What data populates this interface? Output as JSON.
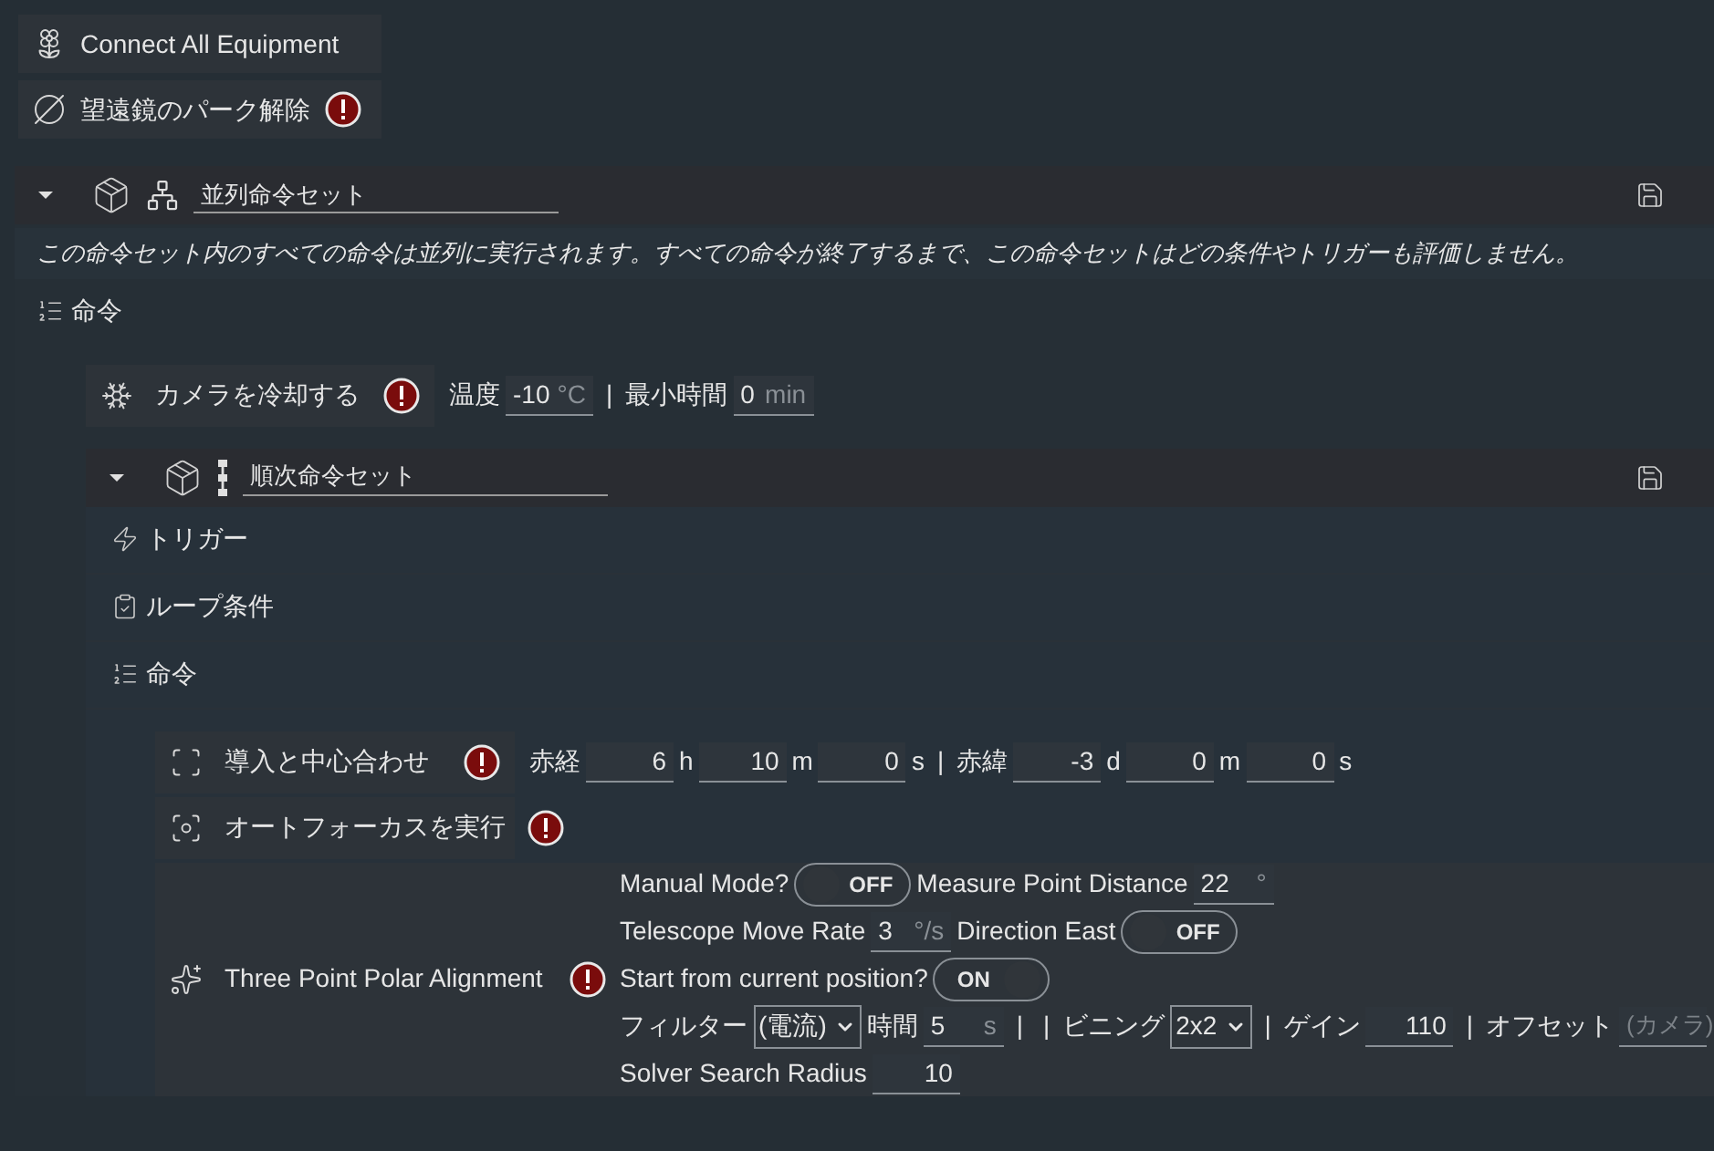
{
  "top_items": [
    {
      "kind": "connect",
      "label": "Connect All Equipment",
      "warning": false
    },
    {
      "kind": "unpark",
      "label": "望遠鏡のパーク解除",
      "warning": true
    }
  ],
  "parallel_set": {
    "title": "並列命令セット",
    "expanded": true,
    "description": "この命令セット内のすべての命令は並列に実行されます。すべての命令が終了するまで、この命令セットはどの条件やトリガーも評価しません。",
    "instructions_label": "命令",
    "items": [
      {
        "kind": "cool",
        "label": "カメラを冷却する",
        "warning": true,
        "lines": [
          {
            "params": [
              {
                "kind": "label",
                "text": "温度"
              },
              {
                "kind": "field",
                "value": "-10",
                "unit": "°C"
              },
              {
                "kind": "sep",
                "text": "|"
              },
              {
                "kind": "label",
                "text": "最小時間"
              },
              {
                "kind": "field",
                "value": "0",
                "unit": "min"
              }
            ]
          }
        ]
      }
    ],
    "sequential_set": {
      "title": "順次命令セット",
      "expanded": true,
      "triggers_label": "トリガー",
      "conditions_label": "ループ条件",
      "instructions_label": "命令",
      "items": [
        {
          "kind": "center",
          "label": "導入と中心合わせ",
          "warning": true,
          "lines": [
            {
              "params": [
                {
                  "kind": "label",
                  "text": "赤経"
                },
                {
                  "kind": "field",
                  "value": "6"
                },
                {
                  "kind": "label",
                  "text": "h"
                },
                {
                  "kind": "field",
                  "value": "10"
                },
                {
                  "kind": "label",
                  "text": "m"
                },
                {
                  "kind": "field",
                  "value": "0"
                },
                {
                  "kind": "label",
                  "text": "s"
                },
                {
                  "kind": "sep",
                  "text": "|"
                },
                {
                  "kind": "label",
                  "text": "赤緯"
                },
                {
                  "kind": "field",
                  "value": "-3"
                },
                {
                  "kind": "label",
                  "text": "d"
                },
                {
                  "kind": "field",
                  "value": "0"
                },
                {
                  "kind": "label",
                  "text": "m"
                },
                {
                  "kind": "field",
                  "value": "0"
                },
                {
                  "kind": "label",
                  "text": "s"
                }
              ]
            }
          ]
        },
        {
          "kind": "autofocus",
          "label": "オートフォーカスを実行",
          "warning": true
        },
        {
          "kind": "polar",
          "label": "Three Point Polar Alignment",
          "warning": true,
          "lines": [
            {
              "params": [
                {
                  "kind": "label",
                  "text": "Manual Mode?"
                },
                {
                  "kind": "toggle",
                  "text": "OFF",
                  "on": false
                },
                {
                  "kind": "label",
                  "text": "Measure Point Distance"
                },
                {
                  "kind": "field",
                  "value": "22",
                  "unit": "°"
                }
              ]
            },
            {
              "params": [
                {
                  "kind": "label",
                  "text": "Telescope Move Rate"
                },
                {
                  "kind": "field",
                  "value": "3",
                  "unit": "°/s"
                },
                {
                  "kind": "label",
                  "text": "Direction East"
                },
                {
                  "kind": "toggle",
                  "text": "OFF",
                  "on": false
                }
              ]
            },
            {
              "params": [
                {
                  "kind": "label",
                  "text": "Start from current position?"
                },
                {
                  "kind": "toggle",
                  "text": "ON",
                  "on": true
                }
              ]
            },
            {
              "params": [
                {
                  "kind": "label",
                  "text": "フィルター"
                },
                {
                  "kind": "select",
                  "value": "(電流)"
                },
                {
                  "kind": "label",
                  "text": "時間"
                },
                {
                  "kind": "field",
                  "value": "5",
                  "unit": "s"
                },
                {
                  "kind": "sep",
                  "text": "|"
                },
                {
                  "kind": "sep",
                  "text": "|"
                },
                {
                  "kind": "label",
                  "text": "ビニング"
                },
                {
                  "kind": "select",
                  "value": "2x2"
                },
                {
                  "kind": "sep",
                  "text": "|"
                },
                {
                  "kind": "label",
                  "text": "ゲイン"
                },
                {
                  "kind": "field",
                  "value": "110"
                },
                {
                  "kind": "sep",
                  "text": "|"
                },
                {
                  "kind": "label",
                  "text": "オフセット"
                },
                {
                  "kind": "field",
                  "placeholder": "(カメラ)"
                }
              ]
            },
            {
              "params": [
                {
                  "kind": "label",
                  "text": "Solver Search Radius"
                },
                {
                  "kind": "field",
                  "value": "10"
                }
              ]
            }
          ]
        }
      ]
    }
  }
}
